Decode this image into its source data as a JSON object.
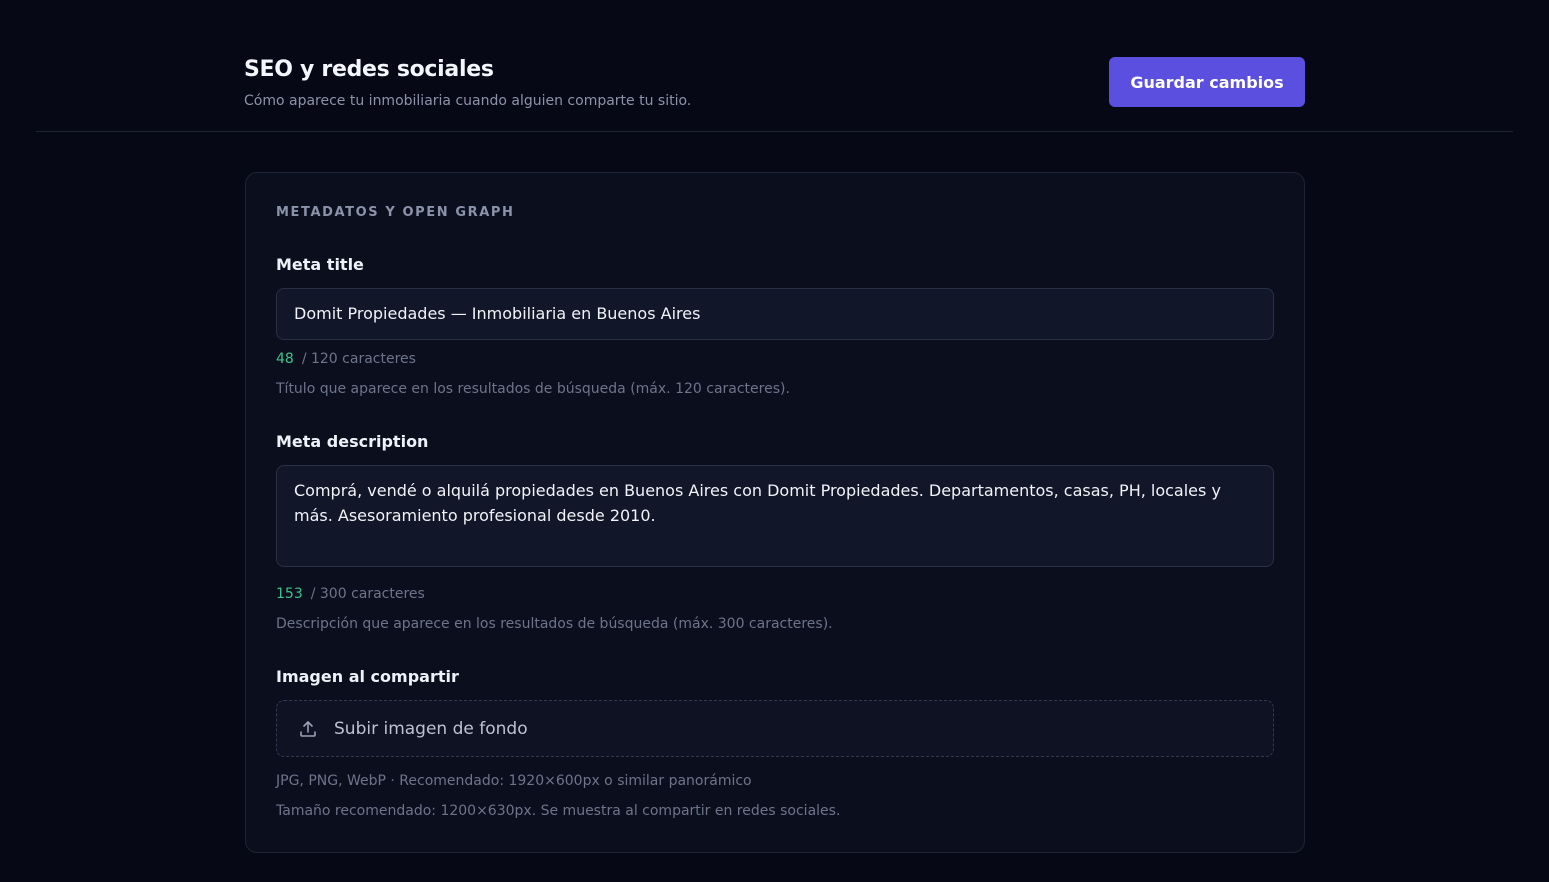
{
  "header": {
    "title": "SEO y redes sociales",
    "subtitle": "Cómo aparece tu inmobiliaria cuando alguien comparte tu sitio.",
    "save_label": "Guardar cambios"
  },
  "card": {
    "section_title": "METADATOS Y OPEN GRAPH",
    "meta_title": {
      "label": "Meta title",
      "value": "Domit Propiedades — Inmobiliaria en Buenos Aires",
      "count": "48",
      "limit_text": "/ 120 caracteres",
      "help": "Título que aparece en los resultados de búsqueda (máx. 120 caracteres)."
    },
    "meta_description": {
      "label": "Meta description",
      "value": "Comprá, vendé o alquilá propiedades en Buenos Aires con Domit Propiedades. Departamentos, casas, PH, locales y más. Asesoramiento profesional desde 2010.",
      "count": "153",
      "limit_text": "/ 300 caracteres",
      "help": "Descripción que aparece en los resultados de búsqueda (máx. 300 caracteres)."
    },
    "share_image": {
      "label": "Imagen al compartir",
      "upload_label": "Subir imagen de fondo",
      "formats_hint": "JPG, PNG, WebP · Recomendado: 1920×600px o similar panorámico",
      "size_hint": "Tamaño recomendado: 1200×630px. Se muestra al compartir en redes sociales."
    }
  },
  "colors": {
    "background": "#060816",
    "card": "#0b0f1d",
    "accent": "#5a4fdf",
    "counter_ok": "#3fc38a"
  },
  "icons": {
    "upload": "upload-icon"
  }
}
